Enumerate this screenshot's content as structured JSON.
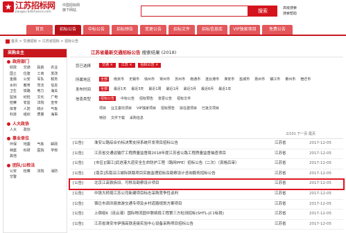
{
  "header": {
    "logo_text": "江苏招标网",
    "logo_url": "jiangsu.bidchance.com",
    "slogan_1": "中国招标网",
    "slogan_2": "旗下网站",
    "search_button": "搜索",
    "link_1": "高级搜索",
    "link_2": "搜索帮助"
  },
  "nav": [
    {
      "label": "首页",
      "active": false
    },
    {
      "label": "招标公告",
      "active": true
    },
    {
      "label": "中标公告",
      "active": false
    },
    {
      "label": "招标预告",
      "active": false
    },
    {
      "label": "变更公告",
      "active": false
    },
    {
      "label": "招标文件",
      "active": false
    },
    {
      "label": "招标信息库",
      "active": false
    },
    {
      "label": "VIP独家项目",
      "active": false
    },
    {
      "label": "免费公告",
      "active": false
    }
  ],
  "breadcrumb": "首页 > 交通招标 > 江苏省招标 > 招标公告",
  "sidebar": {
    "head": "采购业主",
    "sections": [
      {
        "title": "政府部门",
        "items": [
          "财政",
          "交通",
          "民航",
          "农业",
          "国土",
          "住建",
          "工商",
          "发改",
          "金融",
          "公安",
          "军队",
          "税务",
          "水利",
          "教育",
          "司法",
          "信息",
          "卫生",
          "铁路",
          "电力",
          "海关",
          "监狱",
          "纪检",
          "文化",
          "广电",
          "检察",
          "安监",
          "法院",
          "宣传",
          "体育",
          "人防",
          "统计",
          "气象",
          "科技",
          "组织",
          "质量",
          "海事"
        ]
      },
      {
        "title": "人大政协",
        "items": [
          "人大",
          "政协"
        ]
      },
      {
        "title": "事业单位",
        "items": [
          "环保",
          "地震",
          "气象",
          "邮政",
          "档案",
          "科研",
          "医院",
          "学校",
          "其他"
        ]
      },
      {
        "title": "团队/公检法",
        "items": [
          "公安",
          "检察",
          "法院",
          "消防",
          "交警"
        ]
      }
    ]
  },
  "main": {
    "title_prefix": "江苏省最新交通招标公告",
    "title_suffix": "搜索结果 (2018)",
    "selected_label": "您已选择",
    "selected_tags": [
      "交通 ×",
      "江苏 ×",
      "招标公告 ×"
    ],
    "filters": [
      {
        "label": "所属地区",
        "options": [
          "全部",
          "南京市",
          "无锡市",
          "徐州市",
          "常州市",
          "苏州市",
          "南通市",
          "连云港市",
          "淮安市",
          "盐城市",
          "扬州市",
          "镇江市",
          "泰州市",
          "宿迁市"
        ]
      },
      {
        "label": "发布时间",
        "options": [
          "全部",
          "最近1天",
          "最近3天",
          "最近1周",
          "最近1月",
          "最近3月",
          "最近6月",
          "最近1年"
        ]
      },
      {
        "label": "信息类型",
        "options": [
          "招标公告",
          "中标公告",
          "招标预告",
          "变更公告",
          "招标文件"
        ]
      },
      {
        "label": "",
        "options": [
          "项目",
          "业主委托项目",
          "VIP独家项目",
          "招标预告",
          "拟在建项目",
          "已批文项目"
        ]
      },
      {
        "label": "",
        "options": [
          "特别",
          "文件下载",
          "采购信息"
        ]
      }
    ],
    "page_info": "2/101 下一页 尾页"
  },
  "results": [
    {
      "cat": "[公告]",
      "title": "淮安公路综合价标决策支持系统开发项目招标公告",
      "region": "江苏省",
      "date": "2017-12-05"
    },
    {
      "cat": "[公告]",
      "title": "江苏省交通运输厅工程质量监督局2018年度江苏省公路工程质量监督抽查项目",
      "region": "江苏省",
      "date": "2017-12-05"
    },
    {
      "cat": "[公告]",
      "title": "[市区][镇江]武进港大道安全生命防护工程（路网PPE）招标公告（二次）（资格后审）",
      "region": "江苏省",
      "date": "2017-12-05"
    },
    {
      "cat": "[公告]",
      "title": "[南京]苏南沿江城际铁路项目实施监理招标及勘察设计咨询服务招标公告",
      "region": "江苏省",
      "date": "2017-12-05"
    },
    {
      "cat": "[公告]",
      "title": "北京江高铁拆旧、可移及勘察设计项目",
      "region": "江苏省",
      "date": "2017-12-05"
    },
    {
      "cat": "[公告]",
      "title": "中铁大桥局江苏公司新建项目标志采购竞争性谈判",
      "region": "江苏省",
      "date": "2017-12-05"
    },
    {
      "cat": "[公告]",
      "title": "宿迁市泗洪县旅游交通专项及乡村道路规划方案项目",
      "region": "江苏省",
      "date": "2017-12-05"
    },
    {
      "cat": "[公告]",
      "title": "上宿组6（连云港）国际物流园中联络段工程第三方检测招标(SHTL-JC1标段)",
      "region": "江苏省",
      "date": "2017-12-05"
    },
    {
      "cat": "[公告]",
      "title": "江苏省淮安市伊强高铁连接实验中心设备采购项目招标公告",
      "region": "江苏省",
      "date": "2017-12-05"
    }
  ]
}
